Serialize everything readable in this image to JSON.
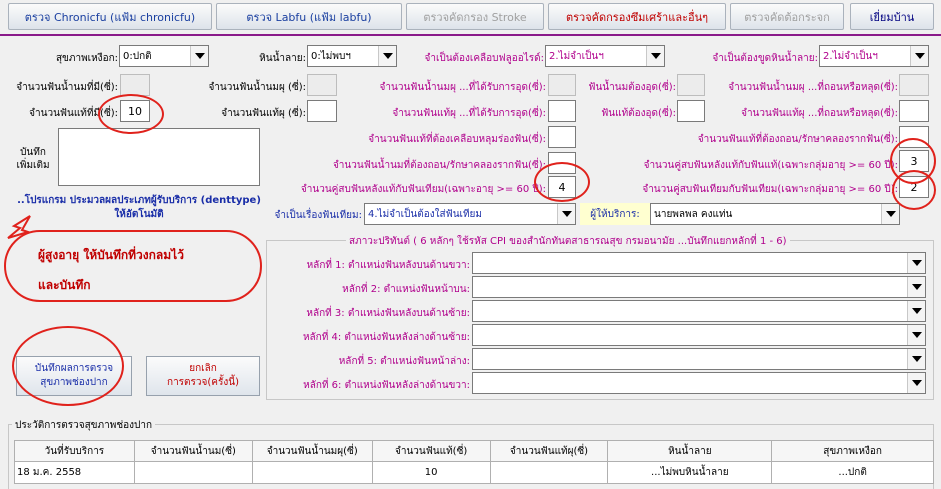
{
  "tabs": [
    "ตรวจ Chronicfu (แฟ้ม chronicfu)",
    "ตรวจ Labfu (แฟ้ม labfu)",
    "ตรวจคัดกรอง Stroke",
    "ตรวจคัดกรองซึมเศร้าและอื่นๆ",
    "ตรวจคัดต้อกระจก",
    "เยี่ยมบ้าน"
  ],
  "form": {
    "gum_label": "สุขภาพเหงือก:",
    "gum_value": "0:ปกติ",
    "calculus_label": "หินน้ำลาย:",
    "calculus_value": "0:ไม่พบฯ",
    "fluoride_label": "จำเป็นต้องเคลือบฟลูออไรด์:",
    "fluoride_value": "2.ไม่จำเป็นฯ",
    "scaling_label": "จำเป็นต้องขูดหินน้ำลาย:",
    "scaling_value": "2.ไม่จำเป็นฯ",
    "row2": [
      "จำนวนฟันน้ำนมที่มี(ซี่):",
      "จำนวนฟันน้ำนมผุ (ซี่):",
      "จำนวนฟันน้ำนมผุ ...ที่ได้รับการอุด(ซี่):",
      "ฟันน้ำนมต้องอุด(ซี่):",
      "จำนวนฟันน้ำนมผุ ...ที่ถอนหรือหลุด(ซี่):"
    ],
    "row3": [
      "จำนวนฟันแท้ที่มี(ซี่):",
      "จำนวนฟันแท้ผุ (ซี่):",
      "จำนวนฟันแท้ผุ ...ที่ได้รับการอุด(ซี่):",
      "ฟันแท้ต้องอุด(ซี่):",
      "จำนวนฟันแท้ผุ ...ที่ถอนหรือหลุด(ซี่):"
    ],
    "perm_teeth_value": "10",
    "sealant_label": "จำนวนฟันแท้ที่ต้องเคลือบหลุมร่องฟัน(ซี่):",
    "perm_extract_label": "จำนวนฟันแท้ที่ต้องถอน/รักษาคลองรากฟัน(ซี่):",
    "note_label": "บันทึก\nเพิ่มเติม",
    "primary_extract_label": "จำนวนฟันน้ำนมที่ต้องถอน/รักษาคลองรากฟัน(ซี่):",
    "pairs_natural_label": "จำนวนคู่สบฟันหลังแท้กับฟันแท้(เฉพาะกลุ่มอายุ >= 60 ปี):",
    "pairs_natural_value": "3",
    "pairs_mixed_label": "จำนวนคู่สบฟันหลังแท้กับฟันเทียม(เฉพาะอายุ >= 60 ปี):",
    "pairs_mixed_value": "4",
    "pairs_denture_label": "จำนวนคู่สบฟันเทียมกับฟันเทียม(เฉพาะกลุ่มอายุ >= 60 ปี):",
    "pairs_denture_value": "2",
    "denture_label": "จำเป็นเรื่องฟันเทียม:",
    "denture_value": "4.ไม่จำเป็นต้องใส่ฟันเทียม",
    "provider_label": "ผู้ให้บริการ:",
    "provider_value": "นายพลพล คงแท่น"
  },
  "info_text": "..โปรแกรม ประมวลผลประเภทผู้รับบริการ (denttype) ให้อัตโนมัติ",
  "annotation": {
    "line1": "ผู้สูงอายุ   ให้บันทึกที่วงกลมไว้",
    "line2": "และบันทึก"
  },
  "cpi": {
    "title": "สภาวะปริทันต์ ( 6 หลักๆ ใช้รหัส CPI ของสำนักทันตสาธารณสุข กรมอนามัย ...บันทึกแยกหลักที่ 1 - 6)",
    "rows": [
      "หลักที่ 1: ตำแหน่งฟันหลังบนด้านขวา:",
      "หลักที่ 2: ตำแหน่งฟันหน้าบน:",
      "หลักที่ 3: ตำแหน่งฟันหลังบนด้านซ้าย:",
      "หลักที่ 4: ตำแหน่งฟันหลังล่างด้านซ้าย:",
      "หลักที่ 5: ตำแหน่งฟันหน้าล่าง:",
      "หลักที่ 6: ตำแหน่งฟันหลังล่างด้านขวา:"
    ]
  },
  "buttons": {
    "save_line1": "บันทึกผลการตรวจ",
    "save_line2": "สุขภาพช่องปาก",
    "cancel_line1": "ยกเลิก",
    "cancel_line2": "การตรวจ(ครั้งนี้)"
  },
  "history": {
    "title": "ประวัติการตรวจสุขภาพช่องปาก",
    "columns": [
      "วันที่รับบริการ",
      "จำนวนฟันน้ำนม(ซี่)",
      "จำนวนฟันน้ำนมผุ(ซี่)",
      "จำนวนฟันแท้(ซี่)",
      "จำนวนฟันแท้ผุ(ซี่)",
      "หินน้ำลาย",
      "สุขภาพเหงือก"
    ],
    "rows": [
      [
        "18 ม.ค. 2558",
        "",
        "",
        "10",
        "",
        "...ไม่พบหินน้ำลาย",
        "...ปกติ"
      ]
    ]
  },
  "colors": {
    "label_magenta": "#b0008c",
    "circle_red": "#e0221c",
    "info_blue": "#1a2ea8",
    "provider_bg": "#ffffd0"
  }
}
